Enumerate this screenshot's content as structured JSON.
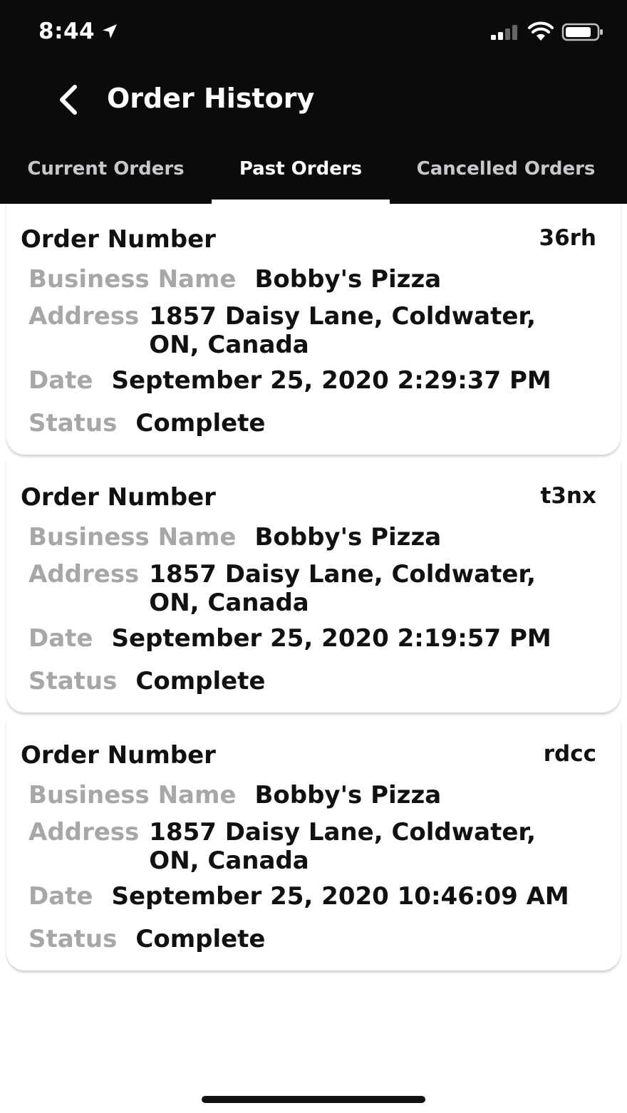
{
  "status_bar": {
    "time": "8:44",
    "icons": [
      "location-arrow-icon",
      "cellular-signal-icon",
      "wifi-icon",
      "battery-icon"
    ]
  },
  "header": {
    "title": "Order History",
    "back_icon": "chevron-left-icon",
    "background_color": "#0b0b0b"
  },
  "tabs": [
    {
      "label": "Current Orders",
      "active": false
    },
    {
      "label": "Past Orders",
      "active": true
    },
    {
      "label": "Cancelled Orders",
      "active": false
    }
  ],
  "orders": [
    {
      "order_number_label": "Order Number",
      "order_number": "36rh",
      "business_name_label": "Business Name",
      "business_name": "Bobby's Pizza",
      "address_label": "Address",
      "address": "1857 Daisy Lane, Coldwater, ON, Canada",
      "date_label": "Date",
      "date": "September 25, 2020 2:29:37 PM",
      "status_label": "Status",
      "status": "Complete"
    },
    {
      "order_number_label": "Order Number",
      "order_number": "t3nx",
      "business_name_label": "Business Name",
      "business_name": "Bobby's Pizza",
      "address_label": "Address",
      "address": "1857 Daisy Lane, Coldwater, ON, Canada",
      "date_label": "Date",
      "date": "September 25, 2020 2:19:57 PM",
      "status_label": "Status",
      "status": "Complete"
    },
    {
      "order_number_label": "Order Number",
      "order_number": "rdcc",
      "business_name_label": "Business Name",
      "business_name": "Bobby's Pizza",
      "address_label": "Address",
      "address": "1857 Daisy Lane, Coldwater, ON, Canada",
      "date_label": "Date",
      "date": "September 25, 2020 10:46:09 AM",
      "status_label": "Status",
      "status": "Complete"
    }
  ]
}
